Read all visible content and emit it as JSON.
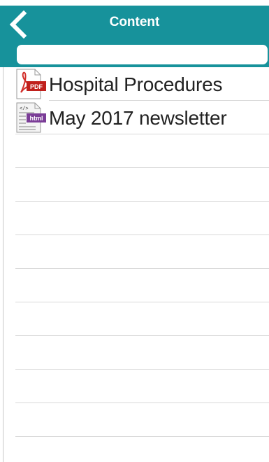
{
  "nav": {
    "title": "Content",
    "back_icon": "chevron-left-icon",
    "background_color": "#17929b"
  },
  "search": {
    "value": "",
    "placeholder": ""
  },
  "items": [
    {
      "label": "Hospital Procedures",
      "icon": "pdf-file-icon"
    },
    {
      "label": "May 2017 newsletter",
      "icon": "html-file-icon"
    }
  ]
}
